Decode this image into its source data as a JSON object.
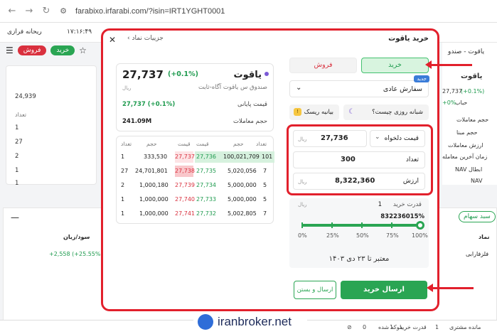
{
  "browser": {
    "url": "farabixo.irfarabi.com/?isin=IRT1YGHT0001"
  },
  "app": {
    "user": "ریحانه فرازی",
    "time": "۱۷:۱۶:۴۹",
    "buy_pill": "خرید",
    "sell_pill": "فروش",
    "bg_left_values": [
      "24,939",
      "تعداد",
      "1",
      "27",
      "2",
      "1",
      "1"
    ],
    "bg_right": {
      "search": "یاقوت - صندو",
      "symbol": "یاقوت",
      "price": "27,737",
      "chg": "(+0.1%)",
      "account": "حباب",
      "acc_pct": "+0%",
      "labels": [
        "حجم معاملات",
        "حجم مبنا",
        "ارزش معاملات",
        "زمان آخرین معامله",
        "NAV ابطال",
        "NAV"
      ]
    },
    "bottom": {
      "basket": "سبد سهام",
      "col_symbol": "نماد",
      "col_pnl": "سود/زیان",
      "row_symbol": "فلزفارابی",
      "row_pnl": "+2,558 (+25.55%)"
    },
    "status": {
      "remaining": "مانده مشتری",
      "remaining_val": "1",
      "power": "قدرت خرید",
      "power_val": "1",
      "blocked": "بلوکه شده",
      "blocked_val": "0"
    }
  },
  "modal": {
    "title_right": "خرید یاقوت",
    "breadcrumb": "جزییات نماد",
    "symbol_card": {
      "name": "یاقوت",
      "desc": "صندوق س یاقوت آگاه-ثابت",
      "price": "27,737",
      "chg": "(+0.1%)",
      "currency": "ریال",
      "rows": [
        {
          "label": "قیمت پایانی",
          "value": "27,737 (+0.1%)"
        },
        {
          "label": "حجم معاملات",
          "value": "241.09M"
        }
      ]
    },
    "orderbook": {
      "headers": [
        "تعداد",
        "حجم",
        "قیمت",
        "قیمت",
        "حجم",
        "تعداد"
      ],
      "rows": [
        {
          "sell_count": "1",
          "sell_vol": "333,530",
          "sell_price": "27,737",
          "buy_price": "27,736",
          "buy_vol": "100,021,709",
          "buy_count": "101"
        },
        {
          "sell_count": "27",
          "sell_vol": "24,701,801",
          "sell_price": "27,738",
          "buy_price": "27,735",
          "buy_vol": "5,020,056",
          "buy_count": "7"
        },
        {
          "sell_count": "2",
          "sell_vol": "1,000,180",
          "sell_price": "27,739",
          "buy_price": "27,734",
          "buy_vol": "5,000,000",
          "buy_count": "5"
        },
        {
          "sell_count": "1",
          "sell_vol": "1,000,000",
          "sell_price": "27,740",
          "buy_price": "27,733",
          "buy_vol": "5,000,000",
          "buy_count": "5"
        },
        {
          "sell_count": "1",
          "sell_vol": "1,000,000",
          "sell_price": "27,741",
          "buy_price": "27,732",
          "buy_vol": "5,002,805",
          "buy_count": "7"
        }
      ]
    },
    "form": {
      "tab_buy": "خرید",
      "tab_sell": "فروش",
      "order_type": "سفارش عادی",
      "badge_new": "جدید",
      "btn_overnight": "شبانه روزی چیست؟",
      "btn_risk": "بیانیه ریسک",
      "price_mode": "قیمت دلخواه",
      "price_value": "27,736",
      "qty_label": "تعداد",
      "qty_value": "300",
      "value_label": "ارزش",
      "value_value": "8,322,360",
      "currency": "ریال",
      "power_label": "قدرت خرید",
      "power_value": "1",
      "power_pct": "832236015%",
      "slider_labels": [
        "0%",
        "25%",
        "50%",
        "75%",
        "100%"
      ],
      "slider_value": 1.0,
      "validity": "معتبر تا ۲۳ دی ۱۴۰۳",
      "send_close": "ارسال و بستن",
      "send": "ارسال خرید"
    }
  },
  "watermark": "iranbroker.net",
  "colors": {
    "accent_red": "#e2202c",
    "buy_green": "#2aa553",
    "sell_red": "#d9303e"
  }
}
